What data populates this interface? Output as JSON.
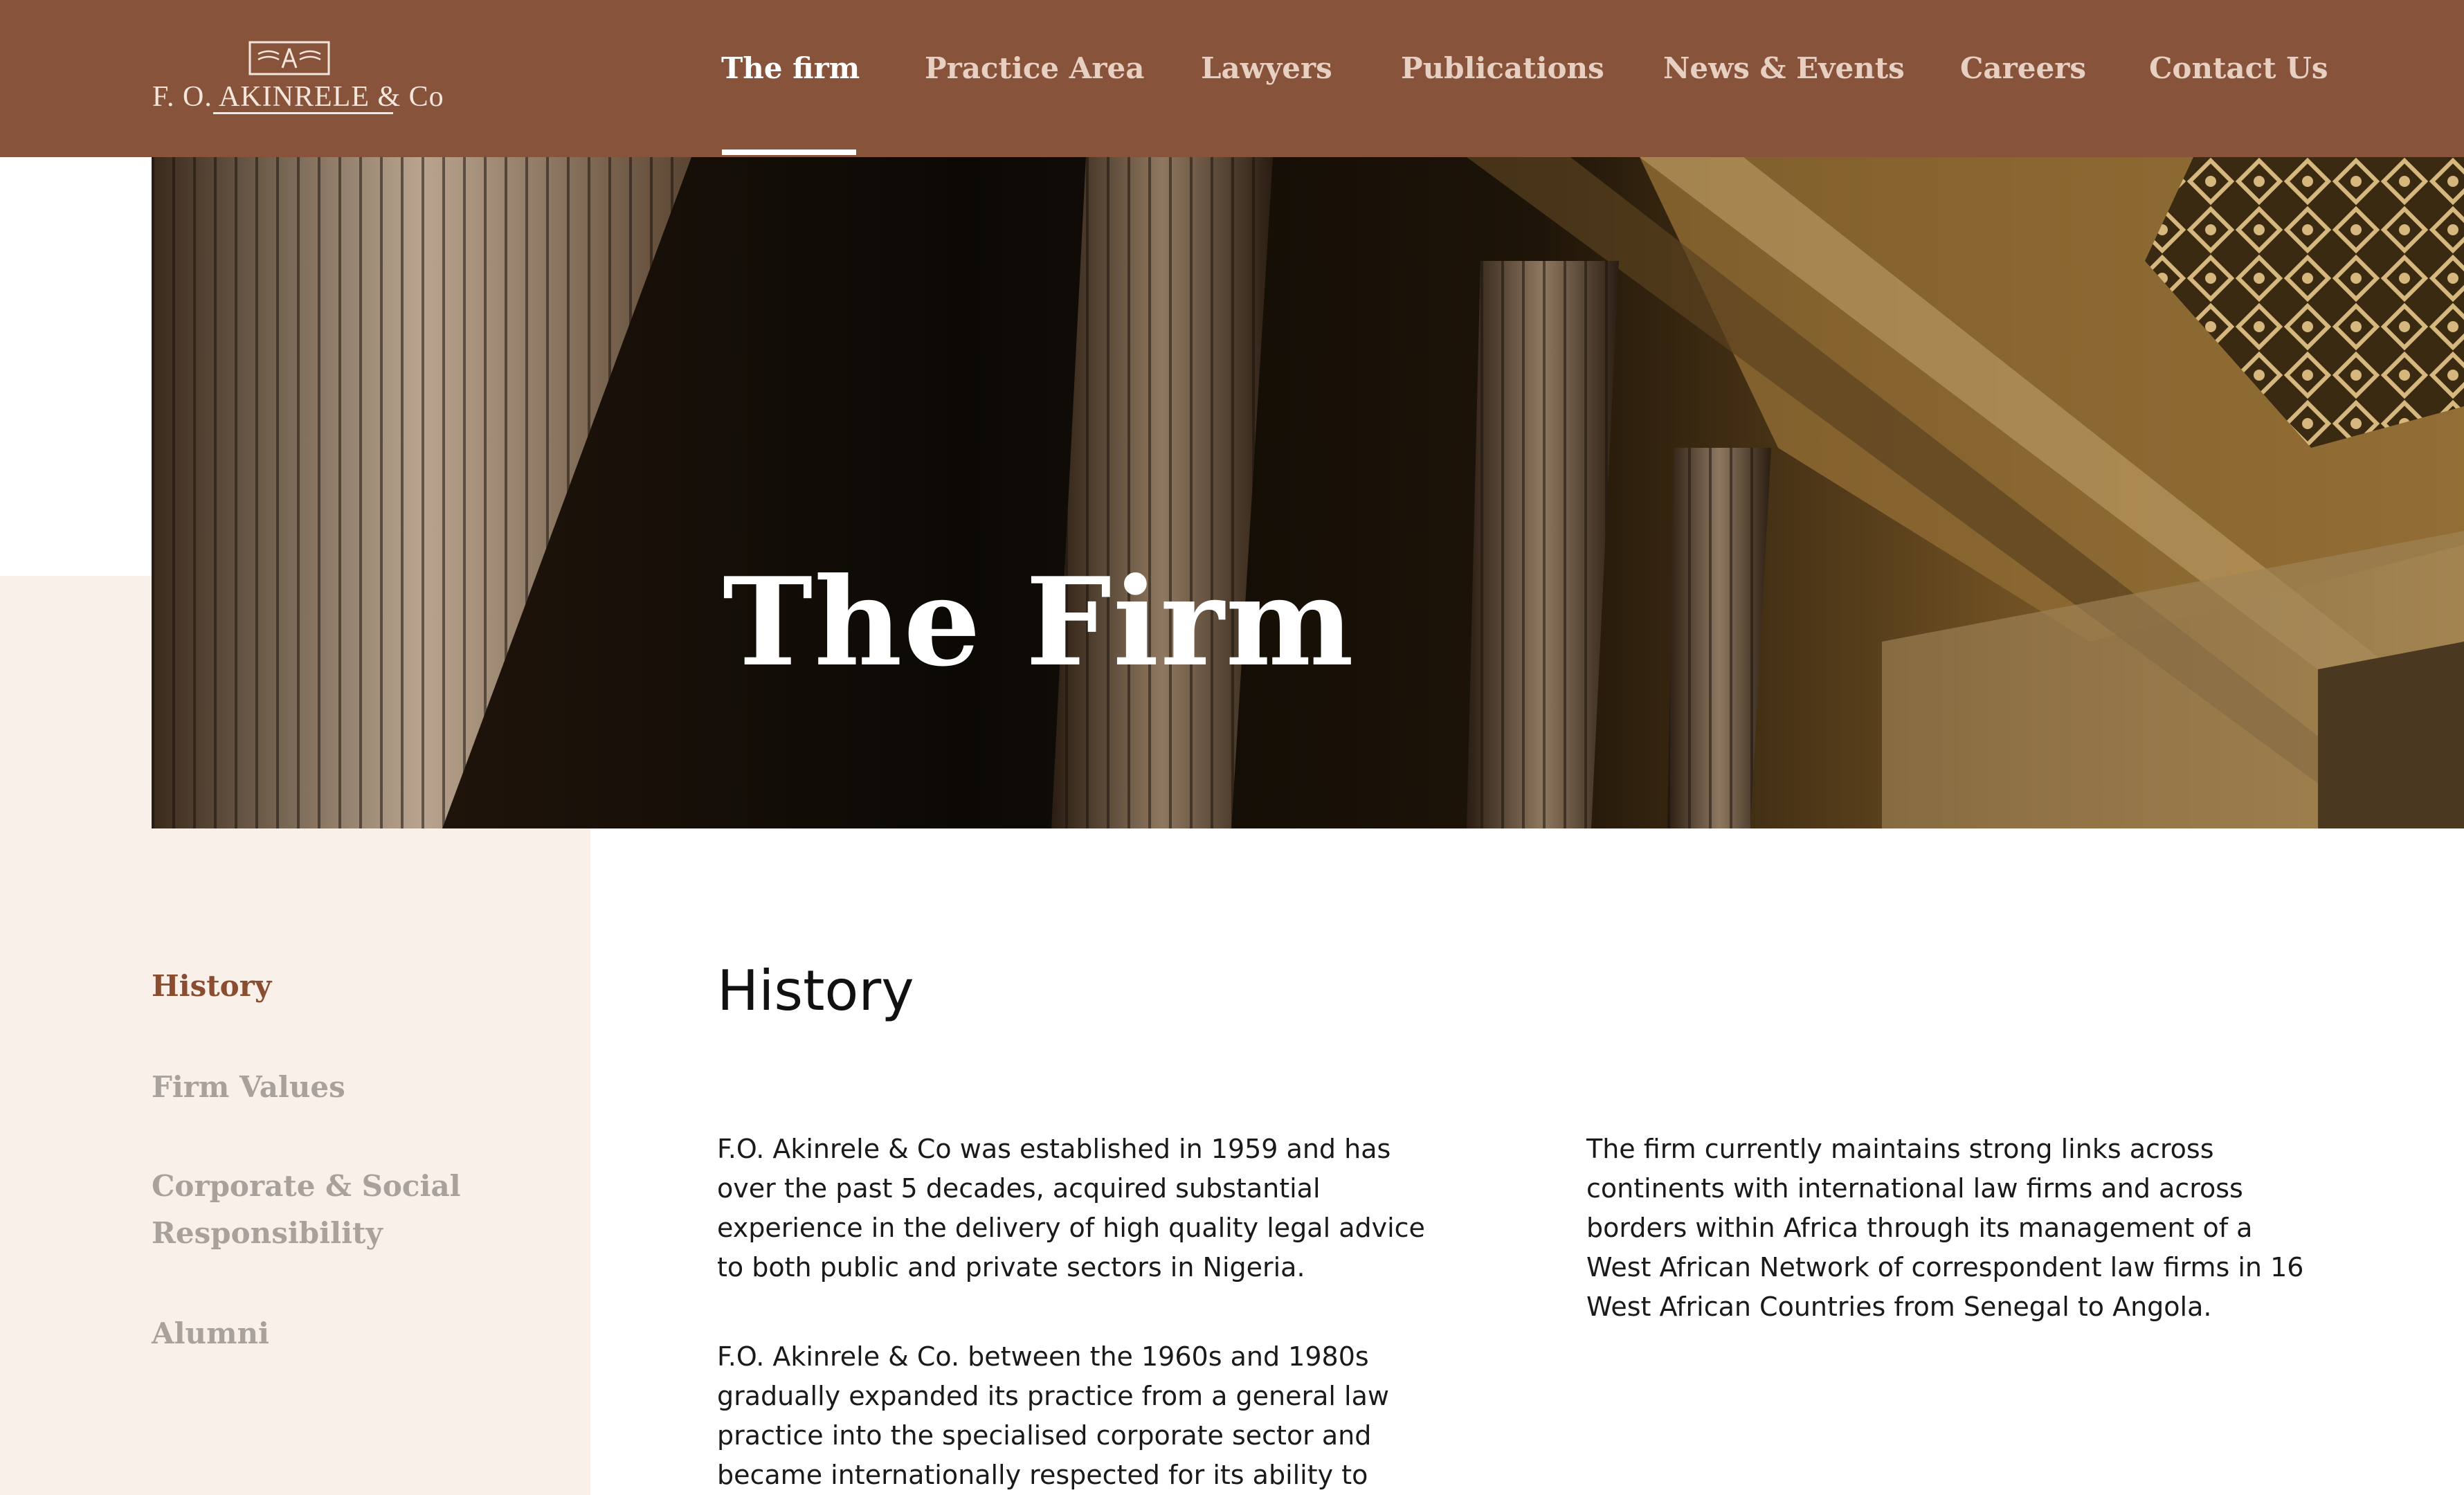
{
  "brand": {
    "name": "F. O. AKINRELE & Co"
  },
  "nav": {
    "items": [
      {
        "label": "The firm",
        "active": true
      },
      {
        "label": "Practice Area"
      },
      {
        "label": "Lawyers"
      },
      {
        "label": "Publications"
      },
      {
        "label": "News & Events"
      },
      {
        "label": "Careers"
      },
      {
        "label": "Contact Us"
      }
    ]
  },
  "hero": {
    "title": "The Firm"
  },
  "sidebar": {
    "items": [
      {
        "label": "History",
        "active": true
      },
      {
        "label": "Firm Values"
      },
      {
        "label": "Corporate & Social Responsibility"
      },
      {
        "label": "Alumni"
      }
    ]
  },
  "content": {
    "title": "History",
    "paragraphs": [
      "F.O. Akinrele & Co was established in 1959 and has over the past 5 decades, acquired substantial experience in the delivery of high quality legal advice to both public and private sectors in Nigeria.",
      "F.O. Akinrele & Co. between the 1960s and 1980s gradually expanded its practice from a general law practice into the specialised corporate sector and became internationally respected for its ability to",
      "The firm currently maintains strong links across continents with international law firms and across borders within Africa through its management of a West African Network of correspondent law firms in 16 West African Countries from Senegal to Angola."
    ]
  },
  "colors": {
    "header": "#87533b",
    "sidebar_bg": "#f9f0ea",
    "active_link": "#8a4d2f",
    "inactive_link": "#a8a19c"
  }
}
